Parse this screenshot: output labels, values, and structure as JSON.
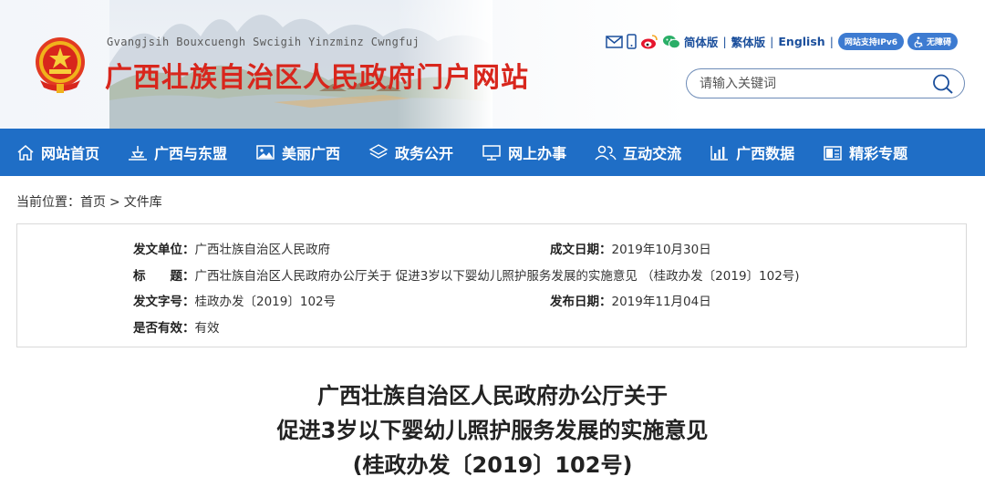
{
  "header": {
    "slogan": "Gvangjsih Bouxcuengh Swcigih Yinzminz Cwngfuj",
    "site_title": "广西壮族自治区人民政府门户网站",
    "links": {
      "simplified": "简体版",
      "traditional": "繁体版",
      "english": "English",
      "ipv6": "网站支持IPv6",
      "accessible": "无障碍"
    },
    "search_placeholder": "请输入关键词"
  },
  "nav": [
    {
      "label": "网站首页",
      "icon": "home-icon"
    },
    {
      "label": "广西与东盟",
      "icon": "landmark-icon"
    },
    {
      "label": "美丽广西",
      "icon": "picture-icon"
    },
    {
      "label": "政务公开",
      "icon": "layers-icon"
    },
    {
      "label": "网上办事",
      "icon": "monitor-icon"
    },
    {
      "label": "互动交流",
      "icon": "users-icon"
    },
    {
      "label": "广西数据",
      "icon": "chart-icon"
    },
    {
      "label": "精彩专题",
      "icon": "topics-icon"
    }
  ],
  "breadcrumb": {
    "prefix": "当前位置：",
    "home": "首页",
    "separator": ">",
    "current": "文件库"
  },
  "info": {
    "issuer_label": "发文单位：",
    "issuer": "广西壮族自治区人民政府",
    "date_label": "成文日期：",
    "date": "2019年10月30日",
    "title_label": "标　　题：",
    "title": "广西壮族自治区人民政府办公厅关于 促进3岁以下婴幼儿照护服务发展的实施意见 （桂政办发〔2019〕102号)",
    "docno_label": "发文字号：",
    "docno": "桂政办发〔2019〕102号",
    "publish_label": "发布日期：",
    "publish": "2019年11月04日",
    "valid_label": "是否有效：",
    "valid": "有效"
  },
  "document": {
    "title_line1": "广西壮族自治区人民政府办公厅关于",
    "title_line2": "促进3岁以下婴幼儿照护服务发展的实施意见",
    "title_line3": "(桂政办发〔2019〕102号)"
  },
  "colors": {
    "nav_bg": "#1f6ec6",
    "title_red": "#d8261c",
    "link_blue": "#1b4f9c"
  }
}
